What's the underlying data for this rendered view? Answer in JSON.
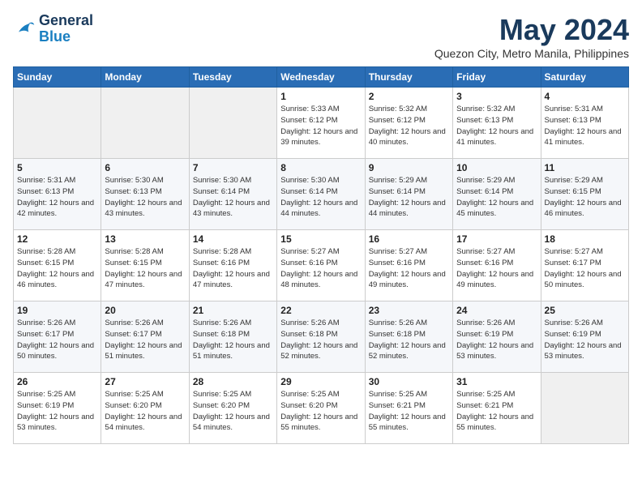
{
  "logo": {
    "line1": "General",
    "line2": "Blue"
  },
  "title": "May 2024",
  "subtitle": "Quezon City, Metro Manila, Philippines",
  "weekdays": [
    "Sunday",
    "Monday",
    "Tuesday",
    "Wednesday",
    "Thursday",
    "Friday",
    "Saturday"
  ],
  "weeks": [
    [
      {
        "day": "",
        "info": ""
      },
      {
        "day": "",
        "info": ""
      },
      {
        "day": "",
        "info": ""
      },
      {
        "day": "1",
        "info": "Sunrise: 5:33 AM\nSunset: 6:12 PM\nDaylight: 12 hours\nand 39 minutes."
      },
      {
        "day": "2",
        "info": "Sunrise: 5:32 AM\nSunset: 6:12 PM\nDaylight: 12 hours\nand 40 minutes."
      },
      {
        "day": "3",
        "info": "Sunrise: 5:32 AM\nSunset: 6:13 PM\nDaylight: 12 hours\nand 41 minutes."
      },
      {
        "day": "4",
        "info": "Sunrise: 5:31 AM\nSunset: 6:13 PM\nDaylight: 12 hours\nand 41 minutes."
      }
    ],
    [
      {
        "day": "5",
        "info": "Sunrise: 5:31 AM\nSunset: 6:13 PM\nDaylight: 12 hours\nand 42 minutes."
      },
      {
        "day": "6",
        "info": "Sunrise: 5:30 AM\nSunset: 6:13 PM\nDaylight: 12 hours\nand 43 minutes."
      },
      {
        "day": "7",
        "info": "Sunrise: 5:30 AM\nSunset: 6:14 PM\nDaylight: 12 hours\nand 43 minutes."
      },
      {
        "day": "8",
        "info": "Sunrise: 5:30 AM\nSunset: 6:14 PM\nDaylight: 12 hours\nand 44 minutes."
      },
      {
        "day": "9",
        "info": "Sunrise: 5:29 AM\nSunset: 6:14 PM\nDaylight: 12 hours\nand 44 minutes."
      },
      {
        "day": "10",
        "info": "Sunrise: 5:29 AM\nSunset: 6:14 PM\nDaylight: 12 hours\nand 45 minutes."
      },
      {
        "day": "11",
        "info": "Sunrise: 5:29 AM\nSunset: 6:15 PM\nDaylight: 12 hours\nand 46 minutes."
      }
    ],
    [
      {
        "day": "12",
        "info": "Sunrise: 5:28 AM\nSunset: 6:15 PM\nDaylight: 12 hours\nand 46 minutes."
      },
      {
        "day": "13",
        "info": "Sunrise: 5:28 AM\nSunset: 6:15 PM\nDaylight: 12 hours\nand 47 minutes."
      },
      {
        "day": "14",
        "info": "Sunrise: 5:28 AM\nSunset: 6:16 PM\nDaylight: 12 hours\nand 47 minutes."
      },
      {
        "day": "15",
        "info": "Sunrise: 5:27 AM\nSunset: 6:16 PM\nDaylight: 12 hours\nand 48 minutes."
      },
      {
        "day": "16",
        "info": "Sunrise: 5:27 AM\nSunset: 6:16 PM\nDaylight: 12 hours\nand 49 minutes."
      },
      {
        "day": "17",
        "info": "Sunrise: 5:27 AM\nSunset: 6:16 PM\nDaylight: 12 hours\nand 49 minutes."
      },
      {
        "day": "18",
        "info": "Sunrise: 5:27 AM\nSunset: 6:17 PM\nDaylight: 12 hours\nand 50 minutes."
      }
    ],
    [
      {
        "day": "19",
        "info": "Sunrise: 5:26 AM\nSunset: 6:17 PM\nDaylight: 12 hours\nand 50 minutes."
      },
      {
        "day": "20",
        "info": "Sunrise: 5:26 AM\nSunset: 6:17 PM\nDaylight: 12 hours\nand 51 minutes."
      },
      {
        "day": "21",
        "info": "Sunrise: 5:26 AM\nSunset: 6:18 PM\nDaylight: 12 hours\nand 51 minutes."
      },
      {
        "day": "22",
        "info": "Sunrise: 5:26 AM\nSunset: 6:18 PM\nDaylight: 12 hours\nand 52 minutes."
      },
      {
        "day": "23",
        "info": "Sunrise: 5:26 AM\nSunset: 6:18 PM\nDaylight: 12 hours\nand 52 minutes."
      },
      {
        "day": "24",
        "info": "Sunrise: 5:26 AM\nSunset: 6:19 PM\nDaylight: 12 hours\nand 53 minutes."
      },
      {
        "day": "25",
        "info": "Sunrise: 5:26 AM\nSunset: 6:19 PM\nDaylight: 12 hours\nand 53 minutes."
      }
    ],
    [
      {
        "day": "26",
        "info": "Sunrise: 5:25 AM\nSunset: 6:19 PM\nDaylight: 12 hours\nand 53 minutes."
      },
      {
        "day": "27",
        "info": "Sunrise: 5:25 AM\nSunset: 6:20 PM\nDaylight: 12 hours\nand 54 minutes."
      },
      {
        "day": "28",
        "info": "Sunrise: 5:25 AM\nSunset: 6:20 PM\nDaylight: 12 hours\nand 54 minutes."
      },
      {
        "day": "29",
        "info": "Sunrise: 5:25 AM\nSunset: 6:20 PM\nDaylight: 12 hours\nand 55 minutes."
      },
      {
        "day": "30",
        "info": "Sunrise: 5:25 AM\nSunset: 6:21 PM\nDaylight: 12 hours\nand 55 minutes."
      },
      {
        "day": "31",
        "info": "Sunrise: 5:25 AM\nSunset: 6:21 PM\nDaylight: 12 hours\nand 55 minutes."
      },
      {
        "day": "",
        "info": ""
      }
    ]
  ]
}
